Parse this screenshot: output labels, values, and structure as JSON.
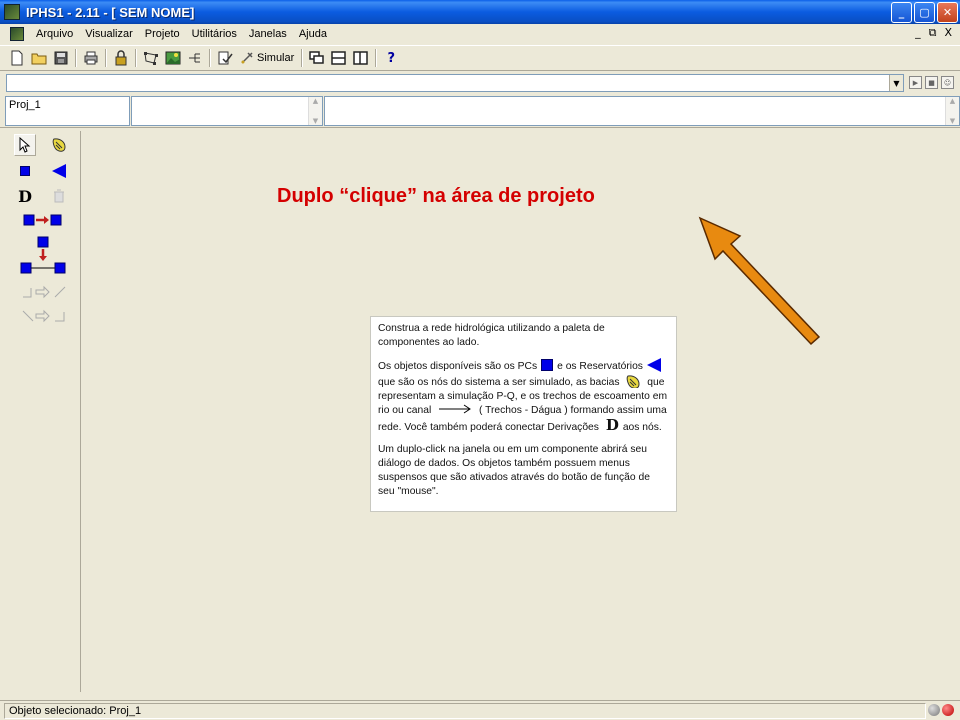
{
  "window": {
    "title": "IPHS1 - 2.11 - [ SEM NOME]"
  },
  "menu": {
    "items": [
      "Arquivo",
      "Visualizar",
      "Projeto",
      "Utilitários",
      "Janelas",
      "Ajuda"
    ]
  },
  "mdi_controls": [
    "_",
    "⧉",
    "X"
  ],
  "toolbar": {
    "simular_label": "Simular",
    "help_label": "?"
  },
  "combo": {
    "value": ""
  },
  "project": {
    "name": "Proj_1"
  },
  "annotation": {
    "text": "Duplo “clique” na área de projeto",
    "color": "#d40000",
    "arrow_color": "#e88a10"
  },
  "info": {
    "p1": "Construa a rede hidrológica utilizando a paleta de componentes ao lado.",
    "p2_a": "Os objetos disponíveis são os PCs",
    "p2_b": "e os Reservatórios",
    "p2_c": "que são os nós do sistema a ser simulado, as bacias",
    "p2_d": "que representam a simulação P-Q, e os trechos de escoamento em rio ou canal",
    "p2_e": "( Trechos - Dágua )  formando assim uma rede. Você também poderá conectar Derivações",
    "p2_f": "aos nós.",
    "p3": "Um duplo-click na janela ou em um componente abrirá seu diálogo de dados. Os objetos também possuem menus suspensos que são ativados através do botão de função de seu \"mouse\"."
  },
  "status": {
    "text": "Objeto selecionado: Proj_1"
  },
  "colors": {
    "component_blue": "#0000e8",
    "titlebar_blue": "#0b5ce0"
  },
  "icons": {
    "toolbar": [
      "new-file-icon",
      "open-folder-icon",
      "save-icon",
      "print-icon",
      "lock-icon",
      "network-icon",
      "image-icon",
      "tree-icon",
      "check-icon",
      "simulate-icon",
      "cascade-icon",
      "tile-horizontal-icon",
      "tile-vertical-icon",
      "help-icon"
    ],
    "palette": [
      "pointer-icon",
      "basin-icon",
      "pc-node-icon",
      "reservoir-icon",
      "derivation-icon",
      "trash-icon",
      "reach-icon",
      "pc-merge-icon",
      "reach-down-icon",
      "reach-up-icon"
    ]
  }
}
